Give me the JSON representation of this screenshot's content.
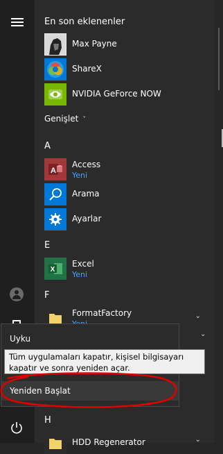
{
  "sections": {
    "recent_title": "En son eklenenler",
    "expand_label": "Genişlet",
    "expand_chevron": "˅"
  },
  "recent_apps": [
    {
      "name": "Max Payne",
      "icon": "max-payne-icon"
    },
    {
      "name": "ShareX",
      "icon": "sharex-icon"
    },
    {
      "name": "NVIDIA GeForce NOW",
      "icon": "nvidia-icon"
    }
  ],
  "letters": {
    "a": "A",
    "e": "E",
    "f": "F",
    "h": "H"
  },
  "apps_a": [
    {
      "name": "Access",
      "sub": "Yeni",
      "icon": "access-icon",
      "color": "#a4373a"
    },
    {
      "name": "Arama",
      "icon": "search-icon",
      "color": "#0078d7"
    },
    {
      "name": "Ayarlar",
      "icon": "gear-icon",
      "color": "#0078d7"
    }
  ],
  "apps_e": [
    {
      "name": "Excel",
      "sub": "Yeni",
      "icon": "excel-icon",
      "color": "#217346"
    }
  ],
  "apps_f": [
    {
      "name": "FormatFactory",
      "sub": "Yeni",
      "icon": "folder-icon",
      "color": "#f2d36b"
    }
  ],
  "apps_h": [
    {
      "name": "HDD Regenerator",
      "icon": "folder-icon",
      "color": "#f2d36b"
    }
  ],
  "power_menu": {
    "sleep": "Uyku",
    "restart": "Yeniden Başlat"
  },
  "tooltip": {
    "text": "Tüm uygulamaları kapatır, kişisel bilgisayarı kapatır ve sonra yeniden açar."
  },
  "colors": {
    "accent": "#0078d7",
    "annotation": "#e00000"
  }
}
